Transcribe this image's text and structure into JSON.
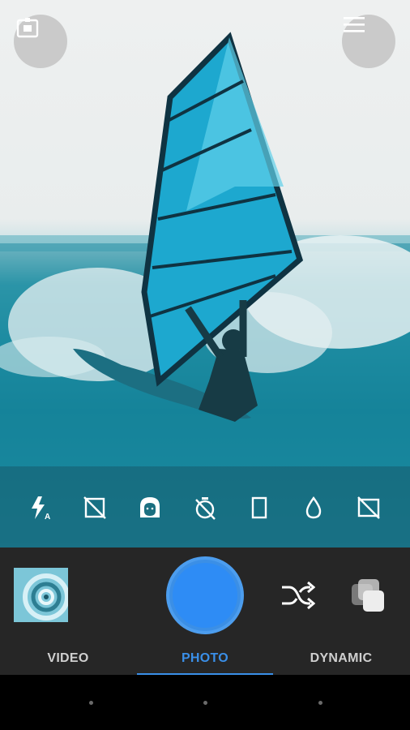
{
  "viewfinder": {
    "scene": "windsurfer-on-wave"
  },
  "top_controls": {
    "switch_camera_icon": "camera-switch-icon",
    "menu_icon": "hamburger-menu-icon"
  },
  "settings": [
    {
      "name": "flash-auto-icon",
      "badge": "A"
    },
    {
      "name": "hdr-off-icon"
    },
    {
      "name": "beauty-face-icon"
    },
    {
      "name": "timer-off-icon"
    },
    {
      "name": "aspect-ratio-icon"
    },
    {
      "name": "water-drop-icon"
    },
    {
      "name": "grid-off-icon"
    }
  ],
  "controls": {
    "gallery_thumbnail": "gallery-thumbnail",
    "shutter": "shutter-button",
    "shuffle_icon": "shuffle-icon",
    "multi_icon": "collage-icon",
    "accent_color": "#3a8fe8"
  },
  "modes": {
    "video": "VIDEO",
    "photo": "PHOTO",
    "dynamic": "DYNAMIC",
    "selected": "PHOTO"
  }
}
